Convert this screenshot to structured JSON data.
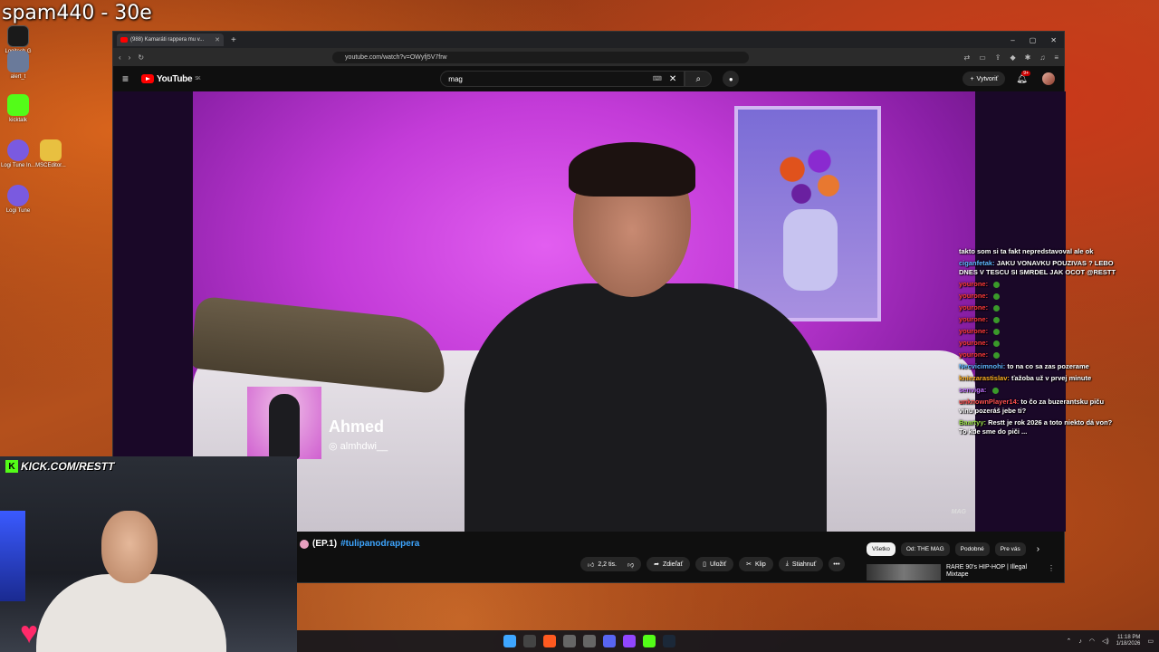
{
  "overlay": {
    "title": "spam440 - 30e",
    "kick_url": "KICK.COM/RESTT"
  },
  "desktop_icons": [
    {
      "label": "Logitech G HUB"
    },
    {
      "label": "alert_t"
    },
    {
      "label": "kicktalk"
    },
    {
      "label": "Logi Tune In..."
    },
    {
      "label": "MSCEditor..."
    },
    {
      "label": "Logi Tune"
    }
  ],
  "browser": {
    "tab_title": "(988) Kamaráti rappera mu v...",
    "url": "youtube.com/watch?v=OWyfj5V7frw"
  },
  "youtube": {
    "logo": "YouTube",
    "logo_region": "SK",
    "search_value": "mag",
    "create_label": "Vytvoriť",
    "notif_count": "9+"
  },
  "video": {
    "guest_name": "Ahmed",
    "guest_handle": "◎ almhdwi__",
    "brand": "MAG",
    "title_prefix": "(EP.1)",
    "title_tag": "#tulipanodrappera"
  },
  "actions": {
    "like": "2,2 tis.",
    "share": "Zdieľať",
    "save": "Uložiť",
    "clip": "Klip",
    "download": "Stiahnuť"
  },
  "chips": [
    "Všetko",
    "Od: THE MAG",
    "Podobné",
    "Pre vás"
  ],
  "recommendation": {
    "title": "RARE 90's HIP-HOP | Illegal Mixtape"
  },
  "chat": [
    {
      "user": "",
      "text": "takto som si ta fakt nepredstavoval ale ok",
      "color": "#ffffff"
    },
    {
      "user": "ciganfetak:",
      "text": "JAKU VONAVKU POUZIVAS ? LEBO DNES V TESCU SI SMRDEL JAK OCOT @RESTT",
      "color": "#5fb6ff"
    },
    {
      "user": "yourone:",
      "text": "",
      "color": "#ff3a3a"
    },
    {
      "user": "yourone:",
      "text": "",
      "color": "#ff3a3a"
    },
    {
      "user": "yourone:",
      "text": "",
      "color": "#ff3a3a"
    },
    {
      "user": "yourone:",
      "text": "",
      "color": "#ff3a3a"
    },
    {
      "user": "yourone:",
      "text": "",
      "color": "#ff3a3a"
    },
    {
      "user": "yourone:",
      "text": "",
      "color": "#ff3a3a"
    },
    {
      "user": "yourone:",
      "text": "",
      "color": "#ff3a3a"
    },
    {
      "user": "Necvicimnohi:",
      "text": "to na co sa zas pozerame",
      "color": "#5fb6ff"
    },
    {
      "user": "kniezarastislav:",
      "text": "ťažoba už v prvej minute",
      "color": "#ffb020"
    },
    {
      "user": "senviga:",
      "text": "",
      "color": "#c070ff"
    },
    {
      "user": "unknownPlayer14:",
      "text": "to čo za buzerantsku piču vinu pozeráš jebe ti?",
      "color": "#ff5050"
    },
    {
      "user": "Baartyy:",
      "text": "Restt je rok 2026 a toto niekto dá von? To kde sme do piči ...",
      "color": "#9adf4a"
    }
  ],
  "taskbar": {
    "time": "11:18 PM",
    "date": "1/18/2026"
  }
}
